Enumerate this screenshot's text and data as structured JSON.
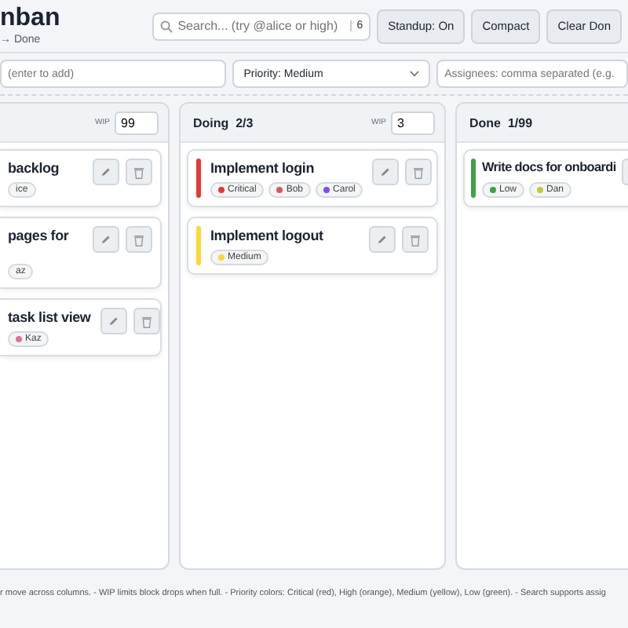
{
  "header": {
    "title": "nban",
    "subtitle": "→ Done"
  },
  "search": {
    "placeholder": "Search... (try @alice or high)",
    "count": "6"
  },
  "buttons": [
    "Standup: On",
    "Compact",
    "Clear Don"
  ],
  "new_card": {
    "title_placeholder": "(enter to add)",
    "priority": "Priority: Medium",
    "assignees_placeholder": "Assignees: comma separated (e.g."
  },
  "columns": [
    {
      "wip_label": "WIP",
      "wip": "99",
      "cards": [
        {
          "title": "backlog",
          "chips": [
            {
              "label": "ice"
            }
          ]
        },
        {
          "title": "pages for",
          "tall": true,
          "chips": [
            {
              "label": "az"
            }
          ]
        },
        {
          "title": "task list view",
          "chips": [
            {
              "label": "Kaz",
              "color": "#e0709a"
            }
          ]
        }
      ]
    },
    {
      "title": "Doing  2/3",
      "wip_label": "WIP",
      "wip": "3",
      "cards": [
        {
          "title": "Implement login",
          "color": "#e53935",
          "chips": [
            {
              "label": "Critical",
              "color": "#e53935"
            },
            {
              "label": "Bob",
              "color": "#e05555"
            },
            {
              "label": "Carol",
              "color": "#7c4dff"
            }
          ]
        },
        {
          "title": "Implement logout",
          "color": "#fdd835",
          "chips": [
            {
              "label": "Medium",
              "color": "#fdd835"
            }
          ]
        }
      ]
    },
    {
      "title": "Done  1/99",
      "cards": [
        {
          "title": "Write docs for onboardi",
          "color": "#43a047",
          "chips": [
            {
              "label": "Low",
              "color": "#43a047"
            },
            {
              "label": "Dan",
              "color": "#c0ca33"
            }
          ]
        }
      ]
    }
  ],
  "footer": "r move across columns. - WIP limits block drops when full. - Priority colors: Critical (red), High (orange), Medium (yellow), Low (green). - Search supports assig"
}
